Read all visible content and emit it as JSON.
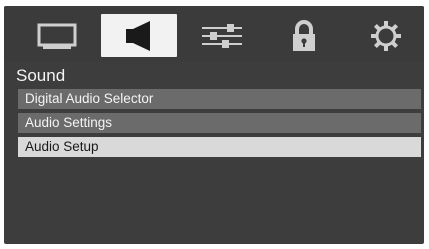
{
  "tabs": [
    {
      "icon": "picture-icon",
      "selected": false
    },
    {
      "icon": "speaker-icon",
      "selected": true
    },
    {
      "icon": "sliders-icon",
      "selected": false
    },
    {
      "icon": "lock-icon",
      "selected": false
    },
    {
      "icon": "gear-icon",
      "selected": false
    }
  ],
  "menu": {
    "title": "Sound",
    "items": [
      {
        "label": "Digital Audio Selector",
        "selected": false
      },
      {
        "label": "Audio Settings",
        "selected": false
      },
      {
        "label": "Audio Setup",
        "selected": true
      }
    ]
  },
  "colors": {
    "background": "#3d3d3d",
    "item_background": "#6b6b6b",
    "selected_background": "#d9d9d9",
    "icon_color": "#d0d0d0",
    "selected_icon_color": "#1a1a1a"
  }
}
